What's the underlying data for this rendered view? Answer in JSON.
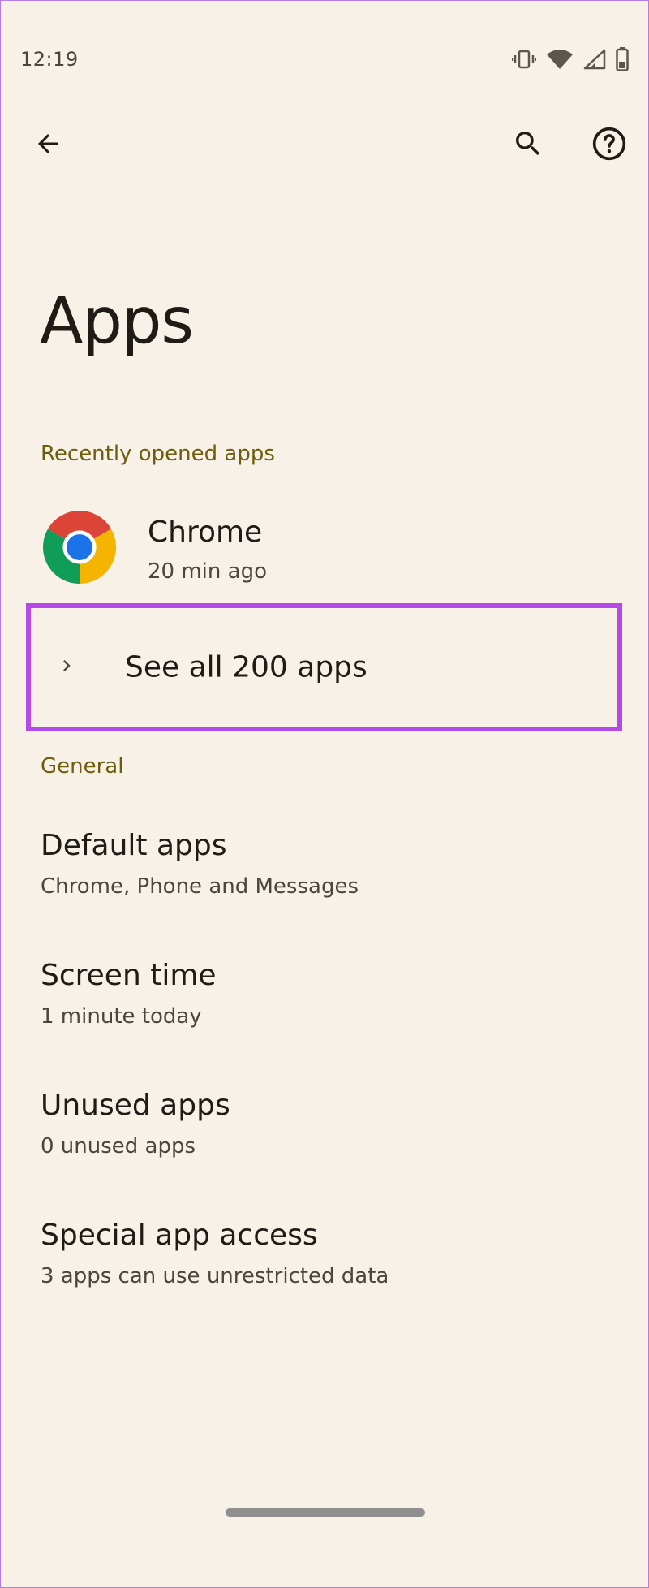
{
  "status_bar": {
    "time": "12:19",
    "icons": [
      "vibrate-icon",
      "wifi-icon",
      "signal-icon",
      "battery-icon"
    ]
  },
  "toolbar": {
    "back_icon": "arrow-left-icon",
    "search_icon": "search-icon",
    "help_icon": "help-circle-icon"
  },
  "page": {
    "title": "Apps"
  },
  "recent": {
    "header": "Recently opened apps",
    "apps": [
      {
        "name": "Chrome",
        "last_opened": "20 min ago",
        "icon": "chrome-icon"
      }
    ],
    "see_all_label": "See all 200 apps",
    "see_all_icon": "chevron-right-icon"
  },
  "general": {
    "header": "General",
    "items": [
      {
        "title": "Default apps",
        "summary": "Chrome, Phone and Messages"
      },
      {
        "title": "Screen time",
        "summary": "1 minute today"
      },
      {
        "title": "Unused apps",
        "summary": "0 unused apps"
      },
      {
        "title": "Special app access",
        "summary": "3 apps can use unrestricted data"
      }
    ]
  },
  "colors": {
    "background": "#f7f1e8",
    "section_header": "#6d5e0f",
    "highlight_border": "#b44be8",
    "text_primary": "#1f1b16",
    "text_secondary": "#4a453f"
  }
}
